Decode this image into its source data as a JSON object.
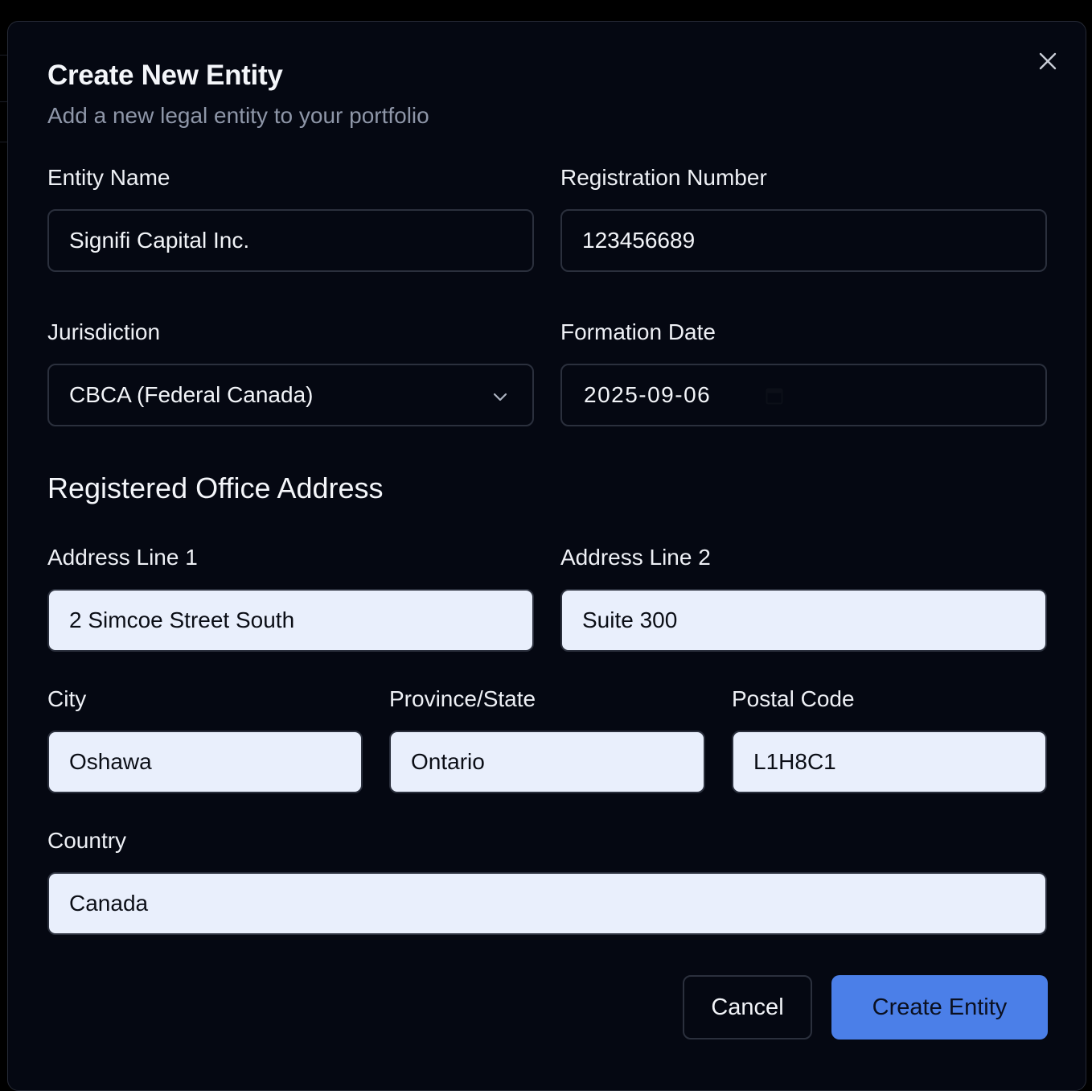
{
  "dialog": {
    "title": "Create New Entity",
    "subtitle": "Add a new legal entity to your portfolio",
    "close_icon": "close-icon"
  },
  "entity_name": {
    "label": "Entity Name",
    "value": "Signifi Capital Inc."
  },
  "registration_number": {
    "label": "Registration Number",
    "value": "123456689"
  },
  "jurisdiction": {
    "label": "Jurisdiction",
    "value": "CBCA (Federal Canada)",
    "icon": "chevron-down-icon"
  },
  "formation_date": {
    "label": "Formation Date",
    "value": "2025-09-06",
    "icon": "calendar-icon"
  },
  "address_section": {
    "title": "Registered Office Address"
  },
  "address_line_1": {
    "label": "Address Line 1",
    "value": "2 Simcoe Street South"
  },
  "address_line_2": {
    "label": "Address Line 2",
    "value": "Suite 300"
  },
  "city": {
    "label": "City",
    "value": "Oshawa"
  },
  "province": {
    "label": "Province/State",
    "value": "Ontario"
  },
  "postal_code": {
    "label": "Postal Code",
    "value": "L1H8C1"
  },
  "country": {
    "label": "Country",
    "value": "Canada"
  },
  "actions": {
    "cancel_label": "Cancel",
    "create_label": "Create Entity"
  },
  "colors": {
    "background": "#050812",
    "border": "#2b303d",
    "filled_input": "#e9effc",
    "primary": "#4b7fe8",
    "muted_text": "#8e96a8"
  }
}
